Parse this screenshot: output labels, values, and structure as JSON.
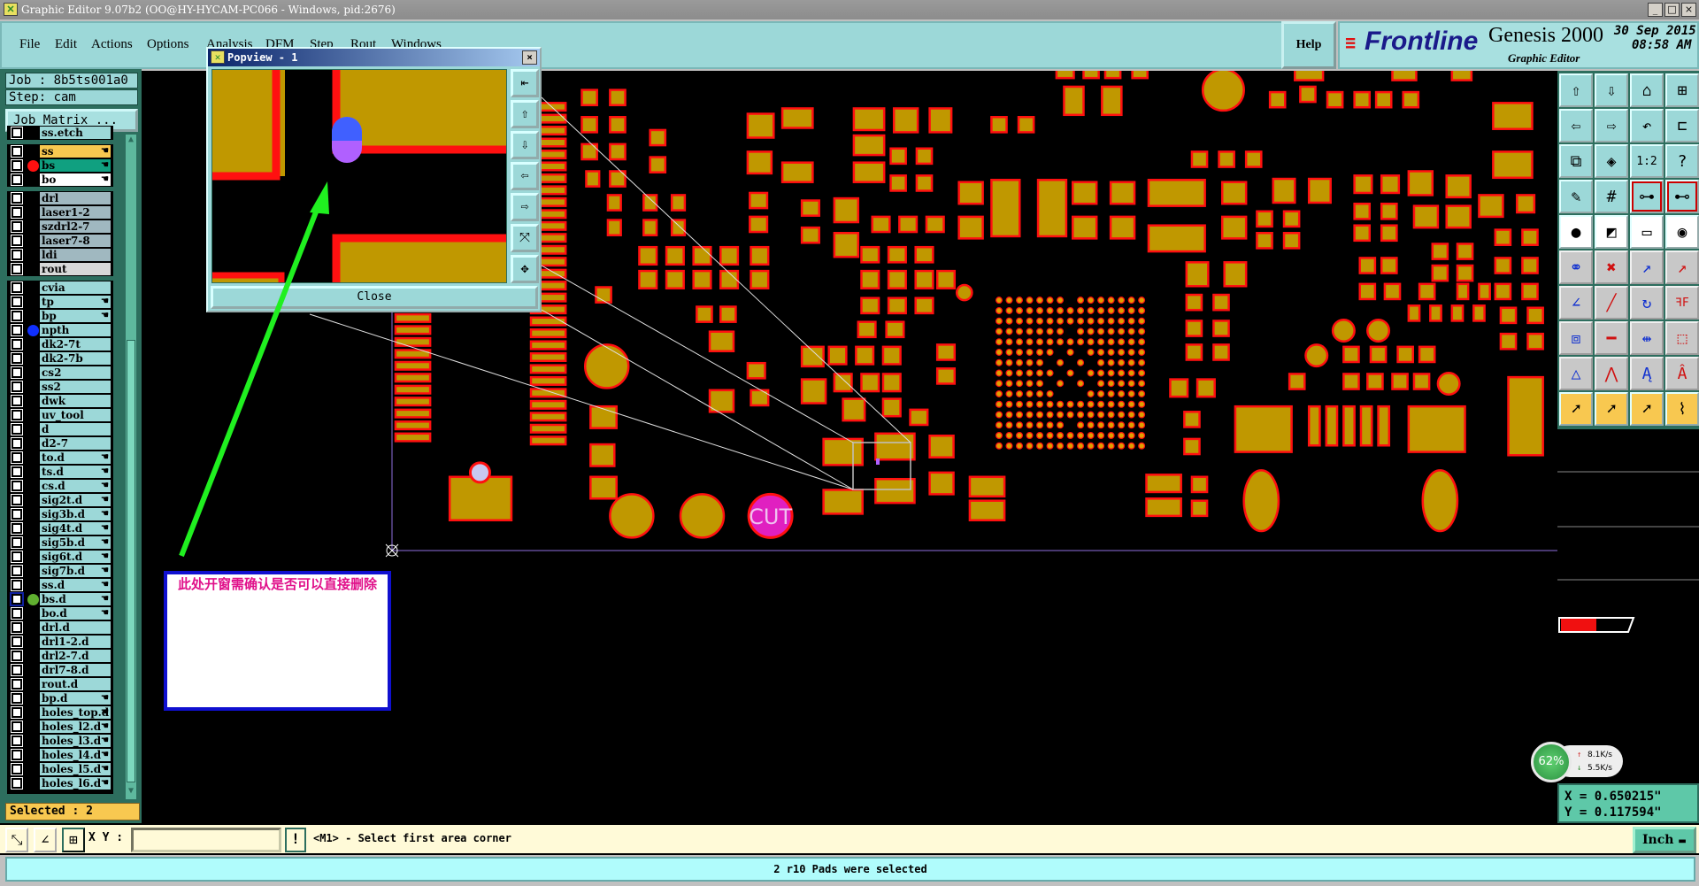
{
  "window": {
    "title": "Graphic Editor 9.07b2 (OO@HY-HYCAM-PC066 - Windows, pid:2676)",
    "minimize": "_",
    "maximize": "□",
    "close": "×"
  },
  "menu": [
    "File",
    "Edit",
    "Actions",
    "Options",
    "Analysis",
    "DFM",
    "Step",
    "Rout",
    "Windows"
  ],
  "help_label": "Help",
  "logo": {
    "brand": "Frontline",
    "product": "Genesis 2000",
    "subtitle": "Graphic Editor",
    "date": "30 Sep 2015",
    "time": "08:58 AM"
  },
  "left_panel": {
    "job": "Job : 8b5ts001a0",
    "step": "Step: cam",
    "job_matrix": "Job Matrix ...",
    "selected": "Selected : 2",
    "layer_groups": [
      [
        {
          "name": "ss.etch",
          "color": "#9cd8d8"
        }
      ],
      [
        {
          "name": "ss",
          "color": "#f8c850",
          "edit": true
        },
        {
          "name": "bs",
          "color": "#10a080",
          "edit": true,
          "marker": "#ff1010"
        },
        {
          "name": "bo",
          "color": "#ffffff",
          "edit": true
        }
      ],
      [
        {
          "name": "drl",
          "color": "#a0b8c0"
        },
        {
          "name": "laser1-2",
          "color": "#a0b8c0"
        },
        {
          "name": "szdrl2-7",
          "color": "#a0b8c0"
        },
        {
          "name": "laser7-8",
          "color": "#a0b8c0"
        },
        {
          "name": "ldi",
          "color": "#a0b8c0"
        },
        {
          "name": "rout",
          "color": "#d8d8d8"
        }
      ],
      [
        {
          "name": "cvia"
        },
        {
          "name": "tp",
          "edit": true
        },
        {
          "name": "bp",
          "edit": true
        },
        {
          "name": "npth",
          "marker": "#1030ff"
        },
        {
          "name": "dk2-7t"
        },
        {
          "name": "dk2-7b"
        },
        {
          "name": "cs2"
        },
        {
          "name": "ss2"
        },
        {
          "name": "dwk"
        },
        {
          "name": "uv_tool"
        },
        {
          "name": "d"
        },
        {
          "name": "d2-7"
        },
        {
          "name": "to.d",
          "edit": true
        },
        {
          "name": "ts.d",
          "edit": true
        },
        {
          "name": "cs.d",
          "edit": true
        },
        {
          "name": "sig2t.d",
          "edit": true
        },
        {
          "name": "sig3b.d",
          "edit": true
        },
        {
          "name": "sig4t.d",
          "edit": true
        },
        {
          "name": "sig5b.d",
          "edit": true
        },
        {
          "name": "sig6t.d",
          "edit": true
        },
        {
          "name": "sig7b.d",
          "edit": true
        },
        {
          "name": "ss.d",
          "edit": true
        },
        {
          "name": "bs.d",
          "edit": true,
          "work": true,
          "marker": "#60b030"
        },
        {
          "name": "bo.d",
          "edit": true
        },
        {
          "name": "drl.d"
        },
        {
          "name": "drl1-2.d"
        },
        {
          "name": "drl2-7.d"
        },
        {
          "name": "drl7-8.d"
        },
        {
          "name": "rout.d"
        },
        {
          "name": "bp.d",
          "edit": true
        },
        {
          "name": "holes_top.d",
          "edit": true
        },
        {
          "name": "holes_l2.d",
          "edit": true
        },
        {
          "name": "holes_l3.d",
          "edit": true
        },
        {
          "name": "holes_l4.d",
          "edit": true
        },
        {
          "name": "holes_l5.d",
          "edit": true
        },
        {
          "name": "holes_l6.d",
          "edit": true
        }
      ]
    ]
  },
  "popview": {
    "title": "Popview - 1",
    "close_label": "Close",
    "buttons": [
      "zoom-back-icon",
      "pan-up-icon",
      "pan-down-icon",
      "pan-left-icon",
      "pan-right-icon",
      "zoom-in-icon",
      "zoom-out-icon"
    ]
  },
  "annotation": {
    "text": "此处开窗需确认是否可以直接删除"
  },
  "canvas": {
    "cut_label": "CUT",
    "pad_fill": "#c09800",
    "pad_outline": "#ff1010",
    "selection_fill": "#b060ff",
    "arrow_color": "#20f020"
  },
  "toolbar_icons": [
    "pan-up-icon",
    "pan-down-icon",
    "home-icon",
    "grid-xy-icon",
    "pan-left-icon",
    "pan-right-icon",
    "undo-view-icon",
    "snap-icon",
    "zoom-fit-icon",
    "zoom-center-icon",
    "scale-1-2-icon",
    "help-icon",
    "tools-palette-icon",
    "grid-icon",
    "layer-top-icon",
    "layer-bottom-icon",
    "move-pad-icon",
    "measure-box-icon",
    "ruler-icon",
    "pad-dot-icon",
    "connect-icon",
    "delete-cross-icon",
    "move-point-icon",
    "move-point-filled-icon",
    "angle-line-icon",
    "line-slant-icon",
    "rotate-icon",
    "mirror-icon",
    "move-square-icon",
    "line-segment-icon",
    "dimension-icon",
    "shapes-icon",
    "triangle-icon",
    "arc-icon",
    "arc-thick-icon",
    "arc-cut-icon",
    "select-arrow-icon",
    "select-box-icon",
    "select-polygon-icon",
    "select-net-icon"
  ],
  "network_widget": {
    "percent": "62%",
    "up": "8.1K/s",
    "down": "5.5K/s"
  },
  "coords": {
    "x": "X = 0.650215\"",
    "y": "Y = 0.117594\""
  },
  "command": {
    "xy_label": "X Y :",
    "xy_value": "",
    "prompt": "<M1> - Select first area corner",
    "units": "Inch"
  },
  "status": "2 r10 Pads were selected"
}
